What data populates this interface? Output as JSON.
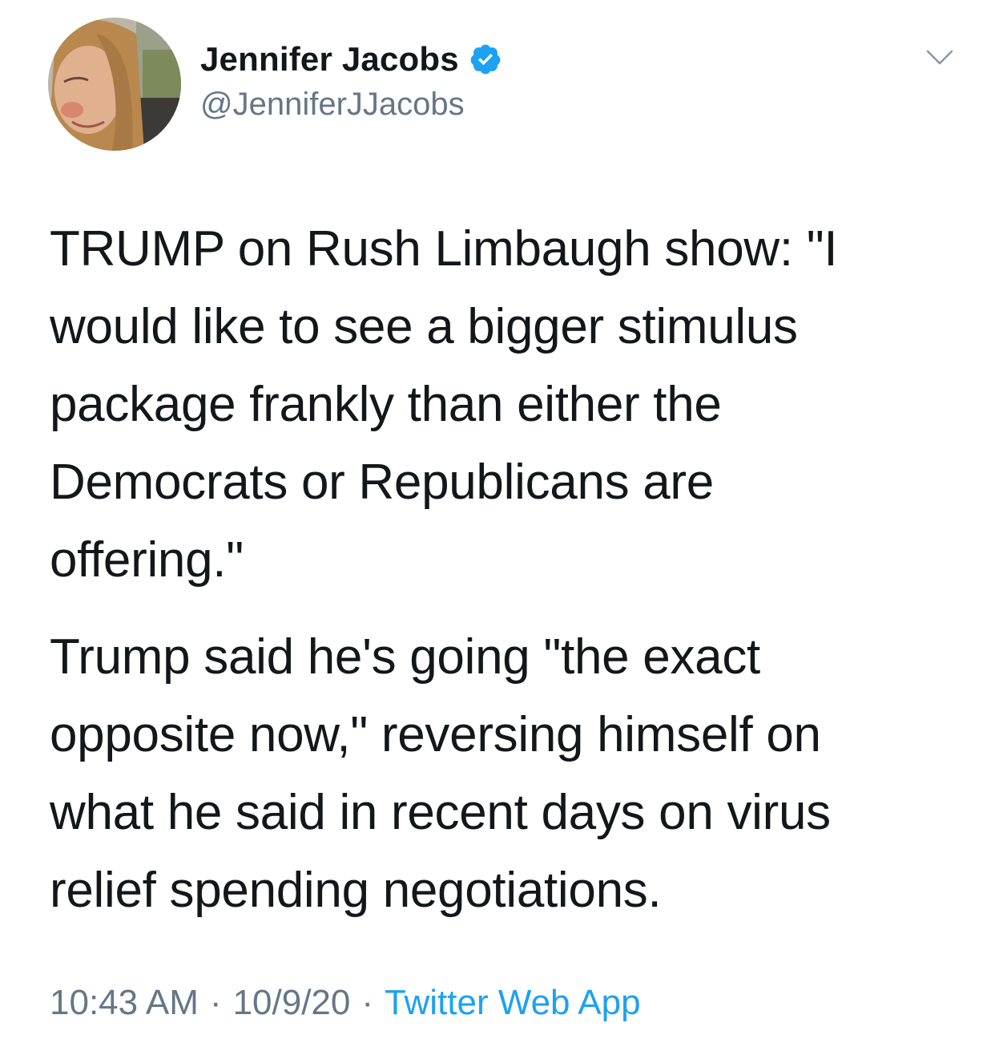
{
  "author": {
    "display_name": "Jennifer Jacobs",
    "handle": "@JenniferJJacobs",
    "verified": true,
    "avatar_icon": "profile-photo"
  },
  "tweet": {
    "paragraphs": [
      "TRUMP on Rush Limbaugh show: \"I\nwould like to see a bigger stimulus\npackage frankly than either the\nDemocrats or Republicans are\noffering.\"",
      "Trump said he's going \"the exact\nopposite now,\" reversing himself on\nwhat he said in recent days on virus\nrelief spending negotiations."
    ],
    "time": "10:43 AM",
    "separator": "·",
    "date": "10/9/20",
    "source": "Twitter Web App"
  },
  "icons": {
    "verified": "verified-badge-icon",
    "menu": "chevron-down-icon"
  },
  "colors": {
    "text": "#14171a",
    "secondary": "#657786",
    "link": "#1da1f2",
    "verified": "#1da1f2"
  }
}
